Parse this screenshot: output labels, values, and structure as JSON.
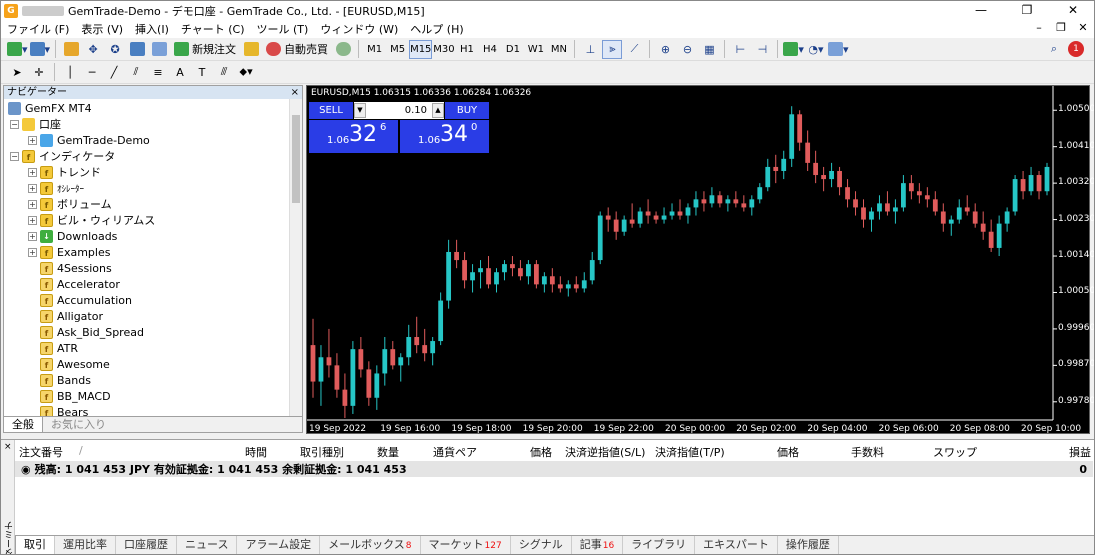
{
  "window": {
    "title": "GemTrade-Demo - デモ口座 - GemTrade Co., Ltd. - [EURUSD,M15]",
    "logo_text": "G",
    "minimize": "—",
    "maximize": "❐",
    "close": "✕"
  },
  "menu": {
    "items": [
      "ファイル (F)",
      "表示 (V)",
      "挿入(I)",
      "チャート (C)",
      "ツール (T)",
      "ウィンドウ (W)",
      "ヘルプ (H)"
    ],
    "mdi_min": "–",
    "mdi_restore": "❐",
    "mdi_close": "✕"
  },
  "toolbar": {
    "new_order": "新規注文",
    "auto_trade": "自動売買",
    "timeframes": [
      "M1",
      "M5",
      "M15",
      "M30",
      "H1",
      "H4",
      "D1",
      "W1",
      "MN"
    ],
    "active_timeframe": "M15",
    "notification_count": "1",
    "draw_text_icon": "A",
    "draw_label_icon": "T"
  },
  "navigator": {
    "title": "ナビゲーター",
    "close": "×",
    "root": "GemFX MT4",
    "accounts_label": "口座",
    "account": "GemTrade-Demo",
    "indicators_label": "インディケータ",
    "groups": [
      "トレンド",
      "ｵｼﾚｰﾀｰ",
      "ボリューム",
      "ビル・ウィリアムス",
      "Downloads",
      "Examples"
    ],
    "indicators": [
      "4Sessions",
      "Accelerator",
      "Accumulation",
      "Alligator",
      "Ask_Bid_Spread",
      "ATR",
      "Awesome",
      "Bands",
      "BB_MACD",
      "Bears"
    ],
    "tab_all": "全般",
    "tab_fav": "お気に入り"
  },
  "chart": {
    "symbol_line": "EURUSD,M15  1.06315 1.06336 1.06284 1.06326",
    "sell_label": "SELL",
    "buy_label": "BUY",
    "lot": "0.10",
    "sell_price": {
      "prefix": "1.06",
      "big": "32",
      "sup": "6"
    },
    "buy_price": {
      "prefix": "1.06",
      "big": "34",
      "sup": "0"
    },
    "colors": {
      "bull": "#26c6c6",
      "bear": "#e05c5c",
      "background": "#000000",
      "panel": "#2a3de6"
    }
  },
  "chart_data": {
    "type": "candlestick",
    "title": "EURUSD,M15",
    "ylim": [
      0.9974,
      1.0055
    ],
    "yticks": [
      "1.00500",
      "1.00410",
      "1.00320",
      "1.00230",
      "1.00140",
      "1.00050",
      "0.99960",
      "0.99870",
      "0.99780"
    ],
    "xticks": [
      "19 Sep 2022",
      "19 Sep 16:00",
      "19 Sep 18:00",
      "19 Sep 20:00",
      "19 Sep 22:00",
      "20 Sep 00:00",
      "20 Sep 02:00",
      "20 Sep 04:00",
      "20 Sep 06:00",
      "20 Sep 08:00",
      "20 Sep 10:00"
    ],
    "series": [
      {
        "name": "EURUSD,M15",
        "ohlc": [
          [
            0.9992,
            0.99985,
            0.9979,
            0.9983
          ],
          [
            0.9983,
            0.9992,
            0.9977,
            0.9989
          ],
          [
            0.9989,
            0.9996,
            0.9984,
            0.9987
          ],
          [
            0.9987,
            0.999,
            0.9979,
            0.9981
          ],
          [
            0.9981,
            0.9985,
            0.9974,
            0.9977
          ],
          [
            0.9977,
            0.9993,
            0.9975,
            0.9991
          ],
          [
            0.9991,
            0.9994,
            0.9984,
            0.9986
          ],
          [
            0.9986,
            0.9988,
            0.9977,
            0.9979
          ],
          [
            0.9979,
            0.9987,
            0.9976,
            0.9985
          ],
          [
            0.9985,
            0.9994,
            0.9982,
            0.9991
          ],
          [
            0.9991,
            0.9993,
            0.9986,
            0.9987
          ],
          [
            0.9987,
            0.999,
            0.9983,
            0.9989
          ],
          [
            0.9989,
            0.9997,
            0.9987,
            0.9994
          ],
          [
            0.9994,
            0.9999,
            0.999,
            0.9992
          ],
          [
            0.9992,
            0.9996,
            0.9988,
            0.999
          ],
          [
            0.999,
            0.9994,
            0.9987,
            0.9993
          ],
          [
            0.9993,
            1.0005,
            0.9992,
            1.0003
          ],
          [
            1.0003,
            1.0018,
            1.0001,
            1.0015
          ],
          [
            1.0015,
            1.0018,
            1.0011,
            1.0013
          ],
          [
            1.0013,
            1.0015,
            1.0006,
            1.0008
          ],
          [
            1.0008,
            1.0012,
            1.0005,
            1.001
          ],
          [
            1.001,
            1.0013,
            1.0006,
            1.0011
          ],
          [
            1.0011,
            1.0014,
            1.0006,
            1.0007
          ],
          [
            1.0007,
            1.0011,
            1.0005,
            1.001
          ],
          [
            1.001,
            1.0013,
            1.0008,
            1.0012
          ],
          [
            1.0012,
            1.0014,
            1.0009,
            1.0011
          ],
          [
            1.0011,
            1.0013,
            1.0008,
            1.0009
          ],
          [
            1.0009,
            1.0013,
            1.0007,
            1.0012
          ],
          [
            1.0012,
            1.0013,
            1.0006,
            1.0007
          ],
          [
            1.0007,
            1.001,
            1.0005,
            1.0009
          ],
          [
            1.0009,
            1.0011,
            1.0005,
            1.0007
          ],
          [
            1.0007,
            1.0009,
            1.0005,
            1.0006
          ],
          [
            1.0006,
            1.0008,
            1.0004,
            1.0007
          ],
          [
            1.0007,
            1.0009,
            1.0005,
            1.0006
          ],
          [
            1.0006,
            1.001,
            1.0005,
            1.0008
          ],
          [
            1.0008,
            1.0015,
            1.0007,
            1.0013
          ],
          [
            1.0013,
            1.0025,
            1.0012,
            1.0024
          ],
          [
            1.0024,
            1.0026,
            1.002,
            1.0023
          ],
          [
            1.0023,
            1.0025,
            1.0018,
            1.002
          ],
          [
            1.002,
            1.0024,
            1.0019,
            1.0023
          ],
          [
            1.0023,
            1.0027,
            1.0021,
            1.0022
          ],
          [
            1.0022,
            1.0026,
            1.0021,
            1.0025
          ],
          [
            1.0025,
            1.0028,
            1.0022,
            1.0024
          ],
          [
            1.0024,
            1.0025,
            1.0022,
            1.0023
          ],
          [
            1.0023,
            1.0026,
            1.0022,
            1.0024
          ],
          [
            1.0024,
            1.0027,
            1.0023,
            1.0025
          ],
          [
            1.0025,
            1.0028,
            1.0023,
            1.0024
          ],
          [
            1.0024,
            1.0027,
            1.0022,
            1.0026
          ],
          [
            1.0026,
            1.003,
            1.0024,
            1.0028
          ],
          [
            1.0028,
            1.003,
            1.0025,
            1.0027
          ],
          [
            1.0027,
            1.0031,
            1.0026,
            1.0029
          ],
          [
            1.0029,
            1.003,
            1.0026,
            1.0027
          ],
          [
            1.0027,
            1.0029,
            1.0025,
            1.0028
          ],
          [
            1.0028,
            1.003,
            1.0026,
            1.0027
          ],
          [
            1.0027,
            1.0029,
            1.0025,
            1.0026
          ],
          [
            1.0026,
            1.0029,
            1.0024,
            1.0028
          ],
          [
            1.0028,
            1.0032,
            1.0027,
            1.0031
          ],
          [
            1.0031,
            1.0038,
            1.003,
            1.0036
          ],
          [
            1.0036,
            1.0039,
            1.0032,
            1.0035
          ],
          [
            1.0035,
            1.004,
            1.0033,
            1.0038
          ],
          [
            1.0038,
            1.0051,
            1.0036,
            1.0049
          ],
          [
            1.0049,
            1.005,
            1.004,
            1.0042
          ],
          [
            1.0042,
            1.0045,
            1.0035,
            1.0037
          ],
          [
            1.0037,
            1.004,
            1.0032,
            1.0034
          ],
          [
            1.0034,
            1.0036,
            1.003,
            1.0033
          ],
          [
            1.0033,
            1.0037,
            1.0031,
            1.0035
          ],
          [
            1.0035,
            1.0036,
            1.0029,
            1.0031
          ],
          [
            1.0031,
            1.0033,
            1.0026,
            1.0028
          ],
          [
            1.0028,
            1.003,
            1.0024,
            1.0026
          ],
          [
            1.0026,
            1.0028,
            1.0021,
            1.0023
          ],
          [
            1.0023,
            1.0026,
            1.002,
            1.0025
          ],
          [
            1.0025,
            1.0029,
            1.0023,
            1.0027
          ],
          [
            1.0027,
            1.003,
            1.0024,
            1.0025
          ],
          [
            1.0025,
            1.0028,
            1.0022,
            1.0026
          ],
          [
            1.0026,
            1.0034,
            1.0025,
            1.0032
          ],
          [
            1.0032,
            1.0034,
            1.0028,
            1.003
          ],
          [
            1.003,
            1.0032,
            1.0027,
            1.0029
          ],
          [
            1.0029,
            1.0031,
            1.0026,
            1.0028
          ],
          [
            1.0028,
            1.003,
            1.0024,
            1.0025
          ],
          [
            1.0025,
            1.0027,
            1.002,
            1.0022
          ],
          [
            1.0022,
            1.0024,
            1.0019,
            1.0023
          ],
          [
            1.0023,
            1.0028,
            1.0022,
            1.0026
          ],
          [
            1.0026,
            1.0029,
            1.0024,
            1.0025
          ],
          [
            1.0025,
            1.0027,
            1.0021,
            1.0022
          ],
          [
            1.0022,
            1.0025,
            1.0018,
            1.002
          ],
          [
            1.002,
            1.0023,
            1.0015,
            1.0016
          ],
          [
            1.0016,
            1.0024,
            1.0014,
            1.0022
          ],
          [
            1.0022,
            1.0026,
            1.002,
            1.0025
          ],
          [
            1.0025,
            1.0034,
            1.0024,
            1.0033
          ],
          [
            1.0033,
            1.0035,
            1.0028,
            1.003
          ],
          [
            1.003,
            1.0036,
            1.0029,
            1.0034
          ],
          [
            1.0034,
            1.0035,
            1.0028,
            1.003
          ],
          [
            1.003,
            1.0037,
            1.0029,
            1.0036
          ]
        ]
      }
    ]
  },
  "terminal": {
    "side_label": "ターミナル",
    "close": "×",
    "columns": [
      "注文番号",
      "/",
      "時間",
      "取引種別",
      "数量",
      "通貨ペア",
      "価格",
      "決済逆指値(S/L)",
      "決済指値(T/P)",
      "価格",
      "手数料",
      "スワップ",
      "損益"
    ],
    "balance_line": "残高: 1 041 453 JPY  有効証拠金: 1 041 453  余剰証拠金: 1 041 453",
    "balance_profit": "0",
    "tabs": [
      {
        "label": "取引",
        "badge": ""
      },
      {
        "label": "運用比率",
        "badge": ""
      },
      {
        "label": "口座履歴",
        "badge": ""
      },
      {
        "label": "ニュース",
        "badge": ""
      },
      {
        "label": "アラーム設定",
        "badge": ""
      },
      {
        "label": "メールボックス",
        "badge": "8"
      },
      {
        "label": "マーケット",
        "badge": "127"
      },
      {
        "label": "シグナル",
        "badge": ""
      },
      {
        "label": "記事",
        "badge": "16"
      },
      {
        "label": "ライブラリ",
        "badge": ""
      },
      {
        "label": "エキスパート",
        "badge": ""
      },
      {
        "label": "操作履歴",
        "badge": ""
      }
    ]
  }
}
